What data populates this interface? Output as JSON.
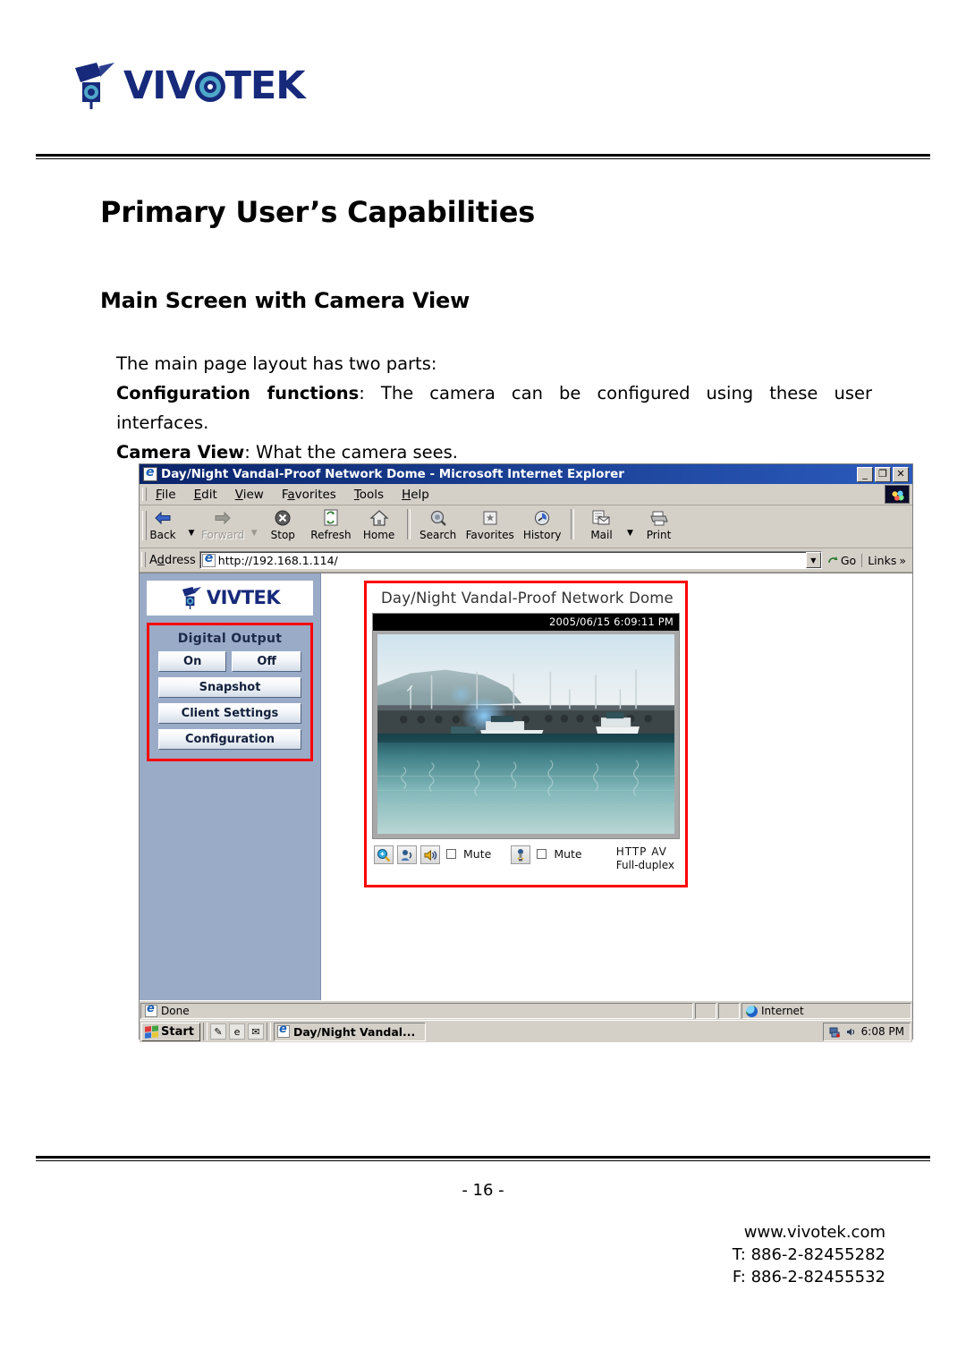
{
  "brand": {
    "name": "VIVOTEK",
    "logo_icon": "vivotek-camera-icon",
    "color": "#16297a"
  },
  "document": {
    "page_title": "Primary User’s Capabilities",
    "section_title": "Main Screen with Camera View",
    "intro": "The main page layout has two parts:",
    "config_label": "Configuration functions",
    "config_text": ": The camera can be configured using these user interfaces.",
    "camera_label": "Camera View",
    "camera_text": ": What the camera sees.",
    "page_number": "- 16 -"
  },
  "footer": {
    "website": "www.vivotek.com",
    "phone": "T: 886-2-82455282",
    "fax": "F: 886-2-82455532"
  },
  "browser": {
    "title": "Day/Night Vandal-Proof Network Dome - Microsoft Internet Explorer",
    "window_buttons": [
      {
        "name": "minimize",
        "glyph": "_"
      },
      {
        "name": "restore",
        "glyph": "❐"
      },
      {
        "name": "close",
        "glyph": "✕"
      }
    ],
    "menu": [
      {
        "label": "File",
        "accel": "F",
        "rest": "ile"
      },
      {
        "label": "Edit",
        "accel": "E",
        "rest": "dit"
      },
      {
        "label": "View",
        "accel": "V",
        "rest": "iew"
      },
      {
        "label": "Favorites",
        "accel": "a",
        "pre": "F",
        "rest": "vorites"
      },
      {
        "label": "Tools",
        "accel": "T",
        "rest": "ools"
      },
      {
        "label": "Help",
        "accel": "H",
        "rest": "elp"
      }
    ],
    "toolbar": [
      {
        "label": "Back",
        "icon": "back-arrow-icon",
        "disabled": false,
        "has_caret": true
      },
      {
        "label": "Forward",
        "icon": "forward-arrow-icon",
        "disabled": true,
        "has_caret": true
      },
      {
        "label": "Stop",
        "icon": "stop-icon",
        "disabled": false,
        "has_caret": false
      },
      {
        "label": "Refresh",
        "icon": "refresh-icon",
        "disabled": false,
        "has_caret": false
      },
      {
        "label": "Home",
        "icon": "home-icon",
        "disabled": false,
        "has_caret": false
      },
      {
        "label": "Search",
        "icon": "search-icon",
        "disabled": false,
        "has_caret": false
      },
      {
        "label": "Favorites",
        "icon": "favorites-star-icon",
        "disabled": false,
        "has_caret": false
      },
      {
        "label": "History",
        "icon": "history-icon",
        "disabled": false,
        "has_caret": false
      },
      {
        "label": "Mail",
        "icon": "mail-icon",
        "disabled": false,
        "has_caret": true
      },
      {
        "label": "Print",
        "icon": "printer-icon",
        "disabled": false,
        "has_caret": false
      }
    ],
    "address": {
      "label": "Address",
      "url": "http://192.168.1.114/",
      "go_label": "Go",
      "links_label": "Links"
    },
    "status": {
      "message": "Done",
      "zone": "Internet"
    }
  },
  "webpage": {
    "sidebar": {
      "logo": "VIVOTEK",
      "panel_title": "Digital Output",
      "buttons": {
        "on": "On",
        "off": "Off",
        "snapshot": "Snapshot",
        "client_settings": "Client Settings",
        "configuration": "Configuration"
      },
      "highlight_color": "#ff0000",
      "background_color": "#9aabc8"
    },
    "camera": {
      "title": "Day/Night Vandal-Proof Network Dome",
      "timestamp": "2005/06/15 6:09:11 PM",
      "controls": {
        "zoom_icon": "digital-zoom-icon",
        "talk_icon": "talk-icon",
        "speaker_icon": "speaker-icon",
        "speaker_mute_label": "Mute",
        "mic_icon": "microphone-icon",
        "mic_mute_label": "Mute",
        "protocol": "HTTP  AV",
        "duplex": "Full-duplex"
      },
      "scene": "harbor with fishing boats, pier and reflections"
    }
  },
  "taskbar": {
    "start_label": "Start",
    "quick_launch": [
      {
        "name": "show-desktop-icon",
        "glyph": "✎"
      },
      {
        "name": "internet-explorer-icon",
        "glyph": "e"
      },
      {
        "name": "outlook-express-icon",
        "glyph": "✉"
      }
    ],
    "task_label": "Day/Night Vandal...",
    "tray_icons": [
      {
        "name": "network-icon",
        "glyph": "▤"
      },
      {
        "name": "volume-icon",
        "glyph": "◂"
      }
    ],
    "clock": "6:08 PM"
  }
}
